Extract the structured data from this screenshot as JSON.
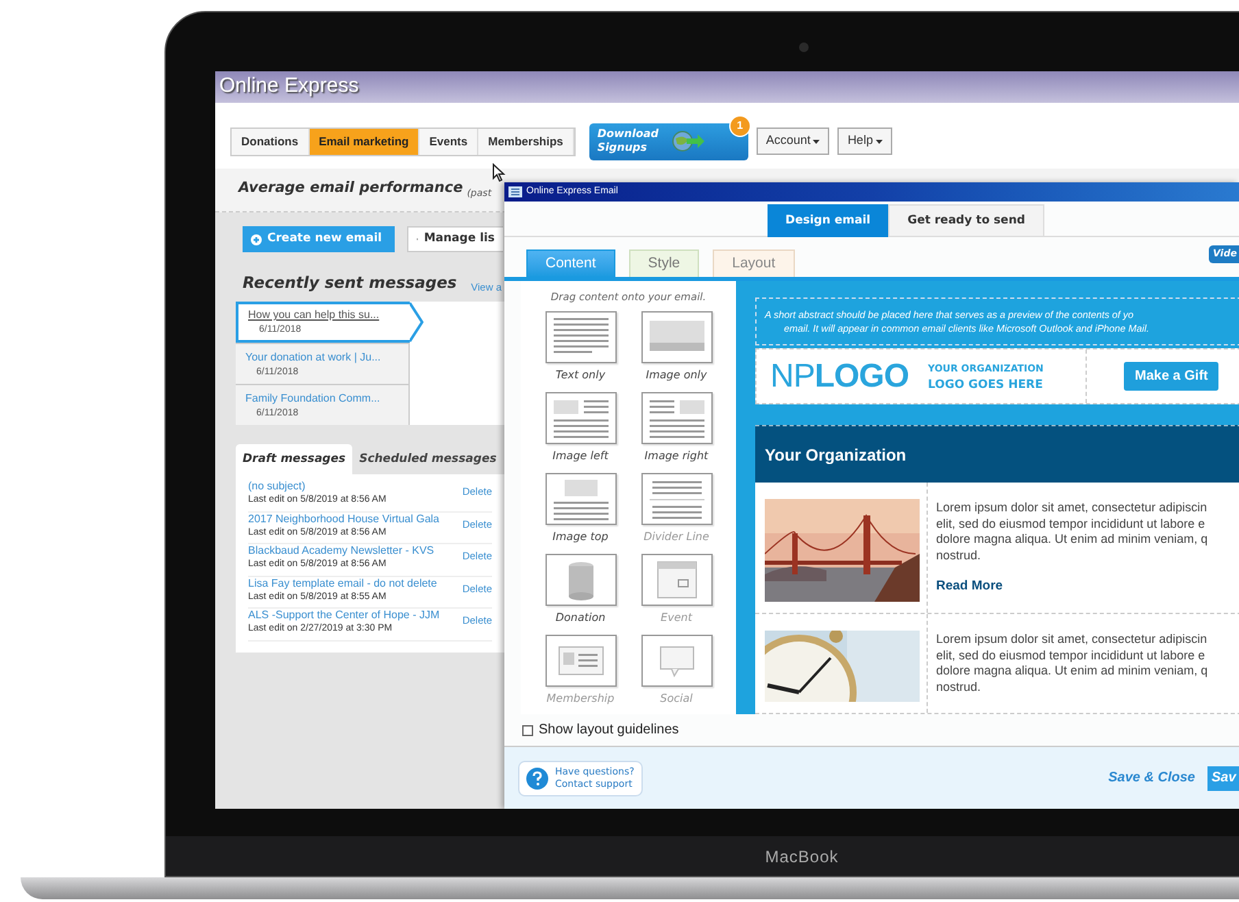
{
  "window": {
    "title": "Online Express"
  },
  "nav_tabs": [
    {
      "label": "Donations",
      "selected": false
    },
    {
      "label": "Email marketing",
      "selected": true
    },
    {
      "label": "Events",
      "selected": false
    },
    {
      "label": "Memberships",
      "selected": false
    }
  ],
  "download_button": {
    "line_1": "Download",
    "line_2": "Signups",
    "badge": "1"
  },
  "menus": [
    "Account",
    "Help"
  ],
  "performance": {
    "title": "Average email performance",
    "subtitle": "(past"
  },
  "actions": [
    {
      "kind": "primary",
      "label": "Create new email"
    },
    {
      "kind": "secondary",
      "label": "Manage lis"
    }
  ],
  "recent": {
    "title": "Recently sent messages",
    "link": "View a",
    "items": [
      {
        "subject": "How you can help this su...",
        "date": "6/11/2018",
        "selected": true
      },
      {
        "subject": "Your donation at work | Ju...",
        "date": "6/11/2018",
        "selected": false
      },
      {
        "subject": "Family Foundation Comm...",
        "date": "6/11/2018",
        "selected": false
      }
    ]
  },
  "message_tabs": [
    {
      "label": "Draft messages",
      "selected": true
    },
    {
      "label": "Scheduled messages",
      "selected": false
    }
  ],
  "drafts": [
    {
      "subject": "(no subject)",
      "edited": "Last edit on 5/8/2019 at 8:56 AM",
      "action": "Delete"
    },
    {
      "subject": "2017 Neighborhood House Virtual Gala",
      "edited": "Last edit on 5/8/2019 at 8:56 AM",
      "action": "Delete"
    },
    {
      "subject": "Blackbaud Academy Newsletter - KVS",
      "edited": "Last edit on 5/8/2019 at 8:56 AM",
      "action": "Delete"
    },
    {
      "subject": "Lisa Fay template email - do not delete",
      "edited": "Last edit on 5/8/2019 at 8:55 AM",
      "action": "Delete"
    },
    {
      "subject": "ALS -Support the Center of Hope - JJM",
      "edited": "Last edit on 2/27/2019 at 3:30 PM",
      "action": "Delete"
    }
  ],
  "email_window": {
    "title": "Online Express Email",
    "steps": [
      {
        "label": "Design email",
        "selected": true
      },
      {
        "label": "Get ready to send",
        "selected": false
      }
    ],
    "tabs": [
      {
        "label": "Content",
        "selected": true,
        "kind": "content"
      },
      {
        "label": "Style",
        "selected": false,
        "kind": "style"
      },
      {
        "label": "Layout",
        "selected": false,
        "kind": "layout"
      }
    ],
    "video_button": "Vide",
    "palette": {
      "hint": "Drag content onto your email.",
      "blocks": [
        {
          "label": "Text only",
          "kind": "text",
          "disabled": false
        },
        {
          "label": "Image only",
          "disabled": false
        },
        {
          "label": "Image left",
          "kind": "image-left",
          "disabled": false
        },
        {
          "label": "Image right",
          "kind": "image-right",
          "disabled": false
        },
        {
          "label": "Image top",
          "kind": "image-top",
          "disabled": false
        },
        {
          "label": "Divider Line",
          "kind": "divider",
          "disabled": true
        },
        {
          "label": "Donation",
          "kind": "donation",
          "disabled": false
        },
        {
          "label": "Event",
          "kind": "event",
          "disabled": true
        },
        {
          "label": "Membership",
          "kind": "membership",
          "disabled": true
        },
        {
          "label": "Social",
          "kind": "social",
          "disabled": true
        }
      ]
    },
    "guidelines": {
      "label": "Show layout guidelines",
      "checked": false
    },
    "support": {
      "line_1": "Have questions?",
      "line_2": "Contact support"
    },
    "save_close": "Save & Close",
    "save": "Sav",
    "preview": {
      "abstract": [
        "A short abstract should be placed here that serves as a preview of the contents of yo",
        "email. It will appear in common email clients like Microsoft Outlook and iPhone Mail."
      ],
      "logo": {
        "part_1": "NP",
        "part_2": "LOGO",
        "tagline_1": "YOUR ORGANIZATION",
        "tagline_2": "LOGO GOES HERE"
      },
      "gift_button": "Make a Gift",
      "banner": "Your Organization",
      "articles": [
        {
          "kind": "bridge",
          "lines": [
            "Lorem ipsum dolor sit amet, consectetur adipiscin",
            "elit, sed do eiusmod tempor incididunt ut labore e",
            "dolore magna aliqua. Ut enim ad minim veniam, q",
            "nostrud."
          ],
          "read_more": "Read More"
        },
        {
          "kind": "clock",
          "lines": [
            "Lorem ipsum dolor sit amet, consectetur adipiscin",
            "elit, sed do eiusmod tempor incididunt ut labore e",
            "dolore magna aliqua. Ut enim ad minim veniam, q",
            "nostrud."
          ]
        }
      ]
    }
  },
  "device_label": "MacBook"
}
